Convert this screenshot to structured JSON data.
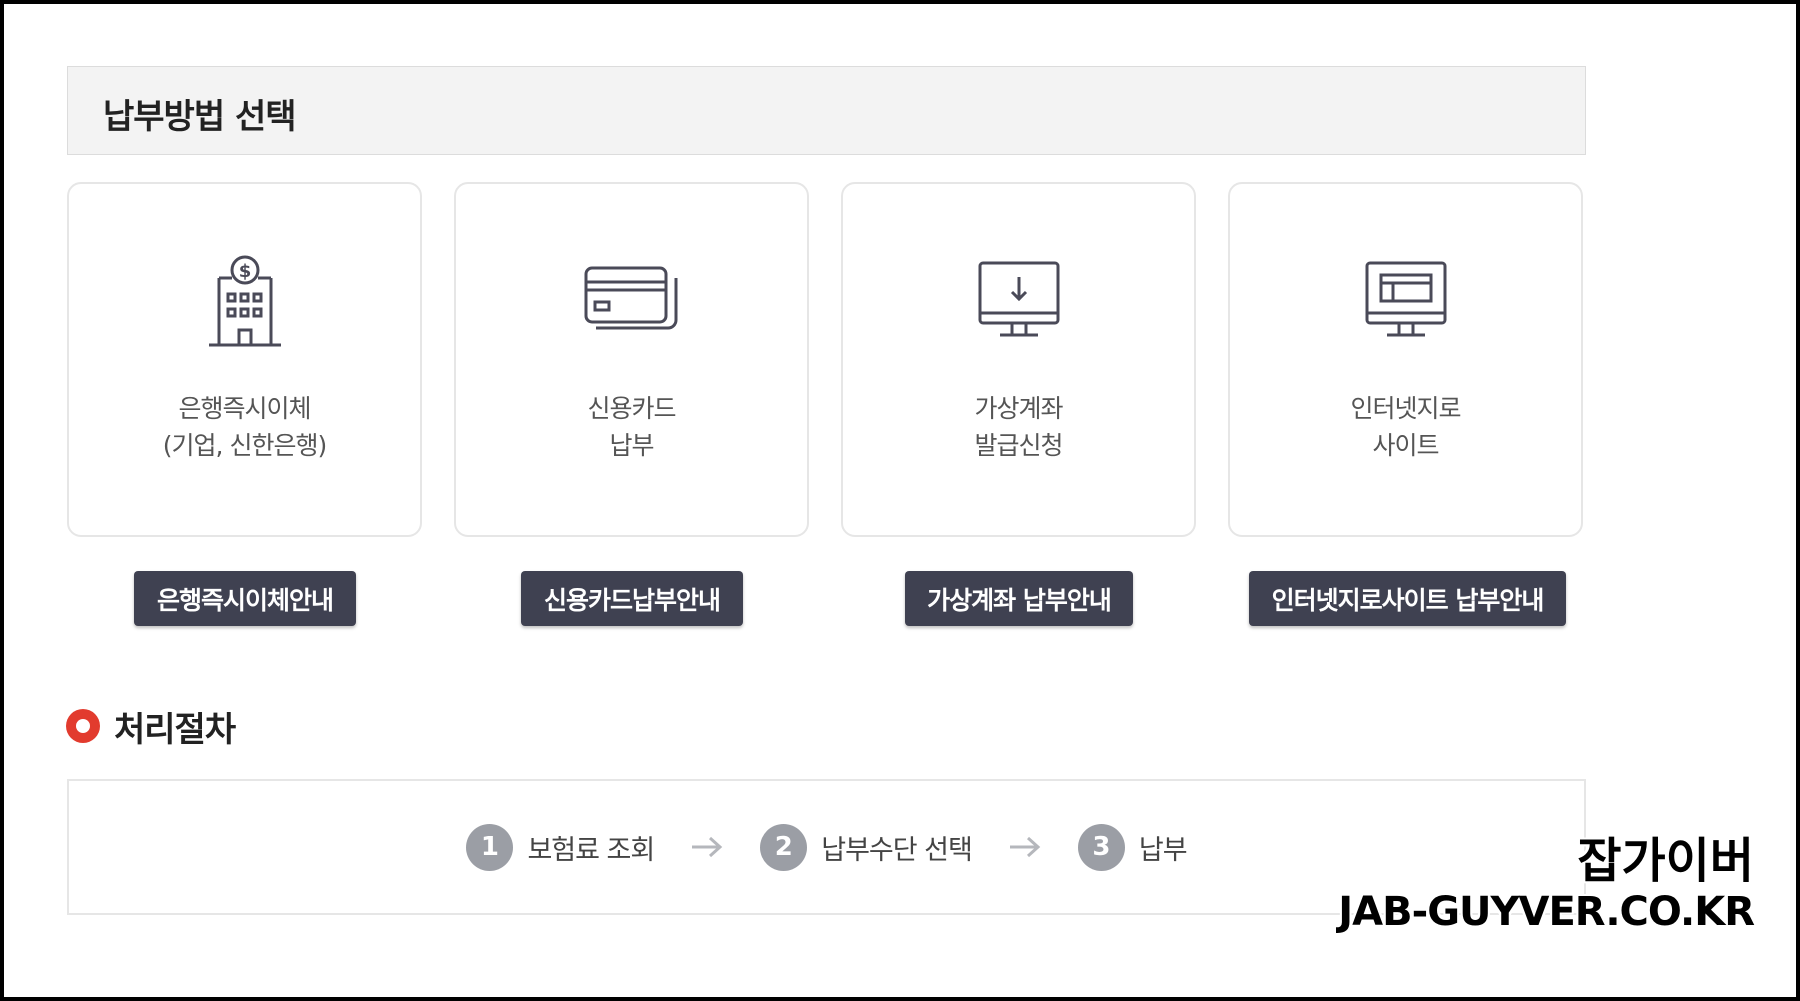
{
  "section": {
    "title": "납부방법 선택"
  },
  "methods": [
    {
      "icon": "bank-building-icon",
      "line1": "은행즉시이체",
      "line2": "(기업, 신한은행)",
      "button": "은행즉시이체안내"
    },
    {
      "icon": "credit-card-icon",
      "line1": "신용카드",
      "line2": "납부",
      "button": "신용카드납부안내"
    },
    {
      "icon": "monitor-download-icon",
      "line1": "가상계좌",
      "line2": "발급신청",
      "button": "가상계좌 납부안내"
    },
    {
      "icon": "monitor-window-icon",
      "line1": "인터넷지로",
      "line2": "사이트",
      "button": "인터넷지로사이트 납부안내"
    }
  ],
  "process": {
    "title": "처리절차",
    "steps": [
      {
        "num": "1",
        "label": "보험료 조회"
      },
      {
        "num": "2",
        "label": "납부수단 선택"
      },
      {
        "num": "3",
        "label": "납부"
      }
    ]
  },
  "watermark": {
    "korean": "잡가이버",
    "url": "JAB-GUYVER.CO.KR"
  },
  "colors": {
    "button_bg": "#3f4151",
    "accent_red": "#e23b2e",
    "step_circle": "#9b9ea5",
    "icon_stroke": "#4a4a58"
  }
}
